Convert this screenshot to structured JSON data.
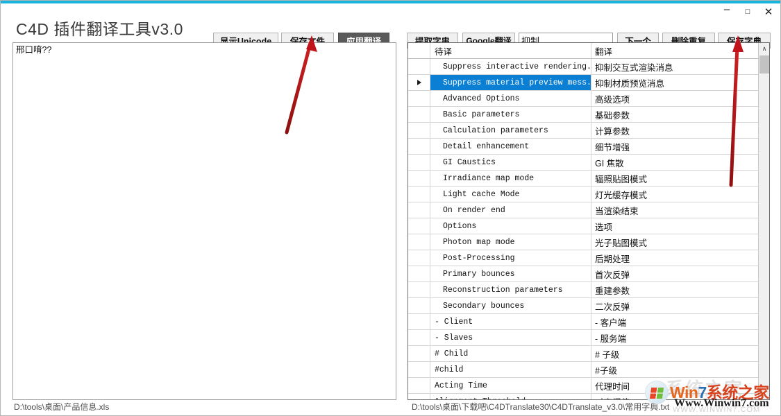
{
  "window": {
    "accent_color": "#19b5dd",
    "controls": [
      {
        "name": "minimize",
        "glyph": "–"
      },
      {
        "name": "maximize",
        "glyph": "□"
      },
      {
        "name": "close",
        "glyph": "✕"
      }
    ]
  },
  "header": {
    "title": "C4D 插件翻译工具v3.0",
    "buttons": {
      "show_unicode": "显示Unicode",
      "save_file": "保存文件",
      "apply_translation": "应用翻译",
      "extract_string": "提取字串",
      "google_translate": "Google翻译",
      "next": "下一个",
      "delete_duplicate": "删除重复",
      "save_dictionary": "保存字典"
    },
    "search": {
      "value": "抑制",
      "placeholder": ""
    }
  },
  "left_pane": {
    "content": "邢口唷??"
  },
  "grid": {
    "columns": {
      "marker": "",
      "source": "待译",
      "target": "翻译"
    },
    "rows": [
      {
        "marker": "",
        "source": "Suppress interactive rendering...",
        "target": "抑制交互式渲染消息",
        "selected": false,
        "indent": true
      },
      {
        "marker": "▶",
        "source": "Suppress material preview mess...",
        "target": "抑制材质预览消息",
        "selected": true,
        "indent": true
      },
      {
        "marker": "",
        "source": "Advanced Options",
        "target": "高级选项",
        "selected": false,
        "indent": true
      },
      {
        "marker": "",
        "source": "Basic parameters",
        "target": "基础参数",
        "selected": false,
        "indent": true
      },
      {
        "marker": "",
        "source": "Calculation parameters",
        "target": "计算参数",
        "selected": false,
        "indent": true
      },
      {
        "marker": "",
        "source": "Detail enhancement",
        "target": "细节增强",
        "selected": false,
        "indent": true
      },
      {
        "marker": "",
        "source": "GI Caustics",
        "target": "GI 焦散",
        "selected": false,
        "indent": true
      },
      {
        "marker": "",
        "source": "Irradiance map mode",
        "target": "辐照贴图模式",
        "selected": false,
        "indent": true
      },
      {
        "marker": "",
        "source": "Light cache Mode",
        "target": "灯光缓存模式",
        "selected": false,
        "indent": true
      },
      {
        "marker": "",
        "source": "On render end",
        "target": "当渲染结束",
        "selected": false,
        "indent": true
      },
      {
        "marker": "",
        "source": "Options",
        "target": "选项",
        "selected": false,
        "indent": true
      },
      {
        "marker": "",
        "source": "Photon map mode",
        "target": "光子贴图模式",
        "selected": false,
        "indent": true
      },
      {
        "marker": "",
        "source": "Post-Processing",
        "target": "后期处理",
        "selected": false,
        "indent": true
      },
      {
        "marker": "",
        "source": "Primary bounces",
        "target": "首次反弹",
        "selected": false,
        "indent": true
      },
      {
        "marker": "",
        "source": "Reconstruction parameters",
        "target": "重建参数",
        "selected": false,
        "indent": true
      },
      {
        "marker": "",
        "source": "Secondary bounces",
        "target": "二次反弹",
        "selected": false,
        "indent": true
      },
      {
        "marker": "",
        "source": "- Client",
        "target": "- 客户端",
        "selected": false,
        "indent": false
      },
      {
        "marker": "",
        "source": "- Slaves",
        "target": "- 服务端",
        "selected": false,
        "indent": false
      },
      {
        "marker": "",
        "source": "# Child",
        "target": "# 子级",
        "selected": false,
        "indent": false
      },
      {
        "marker": "",
        "source": "#child",
        "target": "#子级",
        "selected": false,
        "indent": false
      },
      {
        "marker": "",
        "source": "Acting Time",
        "target": "代理时间",
        "selected": false,
        "indent": false
      },
      {
        "marker": "",
        "source": "Alignment Threshold",
        "target": "对齐阈值",
        "selected": false,
        "indent": false
      }
    ],
    "scrollbar": {
      "up_arrow": "∧"
    }
  },
  "status": {
    "left_path": "D:\\tools\\桌面\\产品信息.xls",
    "right_path": "D:\\tools\\桌面\\下载吧\\C4DTranslate30\\C4DTranslate_v3.0\\常用字典.txt"
  },
  "annotations": {
    "color": "#c0141a",
    "arrow_to_save_file": "arrow pointing to 保存文件",
    "arrow_to_save_dictionary": "arrow pointing to 保存字典"
  },
  "watermark": {
    "brand_win": "Win",
    "brand_7": "7",
    "brand_cn": "系统之家",
    "url": "Www.Winwin7.com"
  }
}
